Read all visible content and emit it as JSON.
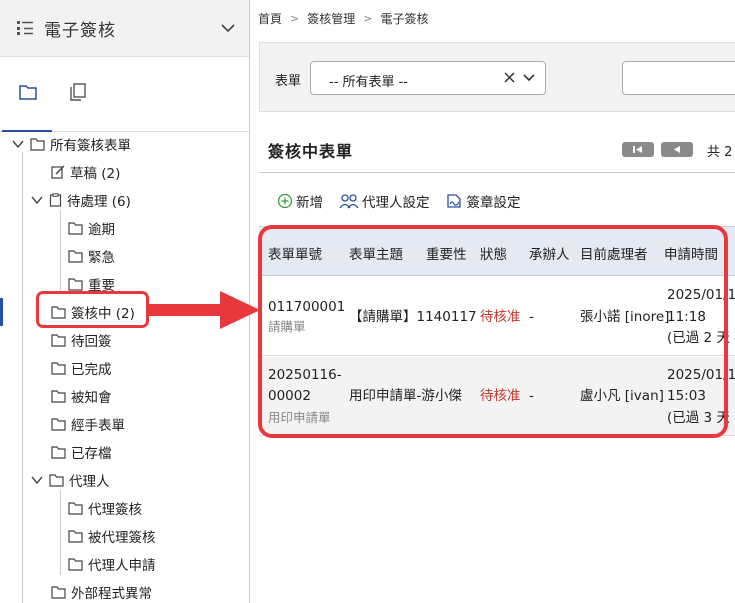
{
  "sidebar": {
    "title": "電子簽核",
    "tree": {
      "root": "所有簽核表單",
      "draft": "草稿 (2)",
      "pending": "待處理 (6)",
      "overdue": "逾期",
      "urgent": "緊急",
      "important": "重要",
      "in_review": "簽核中 (2)",
      "returned": "待回簽",
      "completed": "已完成",
      "notified": "被知會",
      "handled": "經手表單",
      "archived": "已存檔",
      "proxy": "代理人",
      "proxy_sign": "代理簽核",
      "proxied_sign": "被代理簽核",
      "proxy_apply": "代理人申請",
      "external_error": "外部程式異常"
    }
  },
  "breadcrumb": [
    "首頁",
    "簽核管理",
    "電子簽核"
  ],
  "filter": {
    "label": "表單",
    "select_value": "-- 所有表單 --"
  },
  "section": {
    "title": "簽核中表單",
    "pager_text": "共 2"
  },
  "toolbar": {
    "add": "新增",
    "proxy_settings": "代理人設定",
    "seal_settings": "簽章設定"
  },
  "table": {
    "headers": [
      "表單單號",
      "表單主題",
      "重要性",
      "狀態",
      "承辦人",
      "目前處理者",
      "申請時間"
    ],
    "rows": [
      {
        "id": "011700001",
        "form_type": "請購單",
        "subject": "【請購單】1140117",
        "priority": "",
        "status": "待核准",
        "handler": "-",
        "current": "張小諾 [inore]",
        "date": "2025/01/1",
        "time": "11:18",
        "elapsed": "(已過 2 天"
      },
      {
        "id": "20250116-",
        "id2": "00002",
        "form_type": "用印申請單",
        "subject": "用印申請單-游小傑",
        "priority": "",
        "status": "待核准",
        "handler": "-",
        "current": "盧小凡 [ivan]",
        "date": "2025/01/1",
        "time": "15:03",
        "elapsed": "(已過 3 天"
      }
    ]
  },
  "colors": {
    "accent": "#2a4fa0",
    "highlight": "#e8383d",
    "status": "#c0392b"
  }
}
